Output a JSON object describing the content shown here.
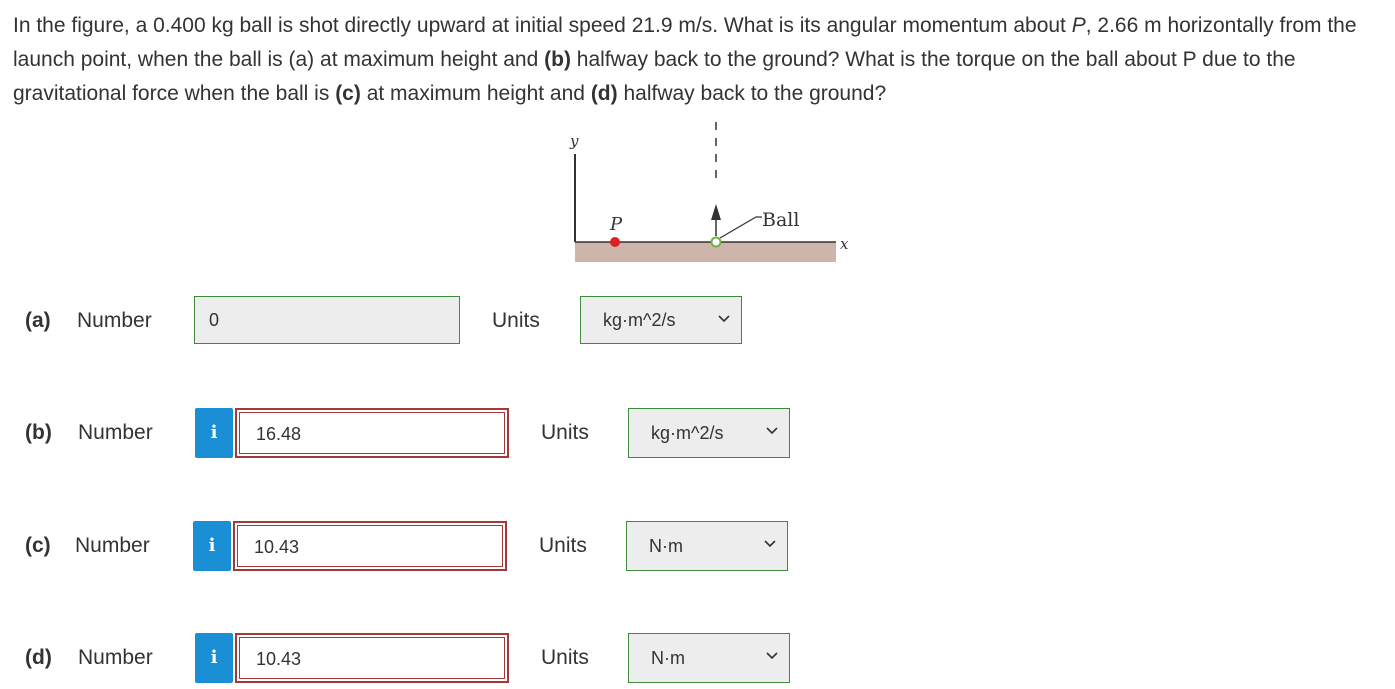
{
  "question": {
    "text_1": "In the figure, a 0.400 kg ball is shot directly upward at initial speed 21.9 m/s. What is its angular momentum about ",
    "p_italic": "P",
    "text_2": ", 2.66 m horizontally from the launch point, when the ball is (a) at maximum height and ",
    "b_label": "(b)",
    "text_3": " halfway back to the ground? What is the torque on the ball about P due to the gravitational force when the ball is ",
    "c_label": "(c)",
    "text_4": " at maximum height and ",
    "d_label": "(d)",
    "text_5": " halfway back to the ground?"
  },
  "figure": {
    "y_label": "y",
    "x_label": "x",
    "p_label": "P",
    "ball_label": "Ball",
    "colors": {
      "ground": "#cdb5ab",
      "point_p": "#e02020",
      "ball": "#6db33f",
      "line": "#333333"
    }
  },
  "rows": [
    {
      "part": "(a)",
      "label": "Number",
      "value": "0",
      "units_label": "Units",
      "units": "kg·m^2/s",
      "has_info": false
    },
    {
      "part": "(b)",
      "label": "Number",
      "value": "16.48",
      "units_label": "Units",
      "units": "kg·m^2/s",
      "has_info": true
    },
    {
      "part": "(c)",
      "label": "Number",
      "value": "10.43",
      "units_label": "Units",
      "units": "N·m",
      "has_info": true
    },
    {
      "part": "(d)",
      "label": "Number",
      "value": "10.43",
      "units_label": "Units",
      "units": "N·m",
      "has_info": true
    }
  ],
  "info_icon": "i",
  "colors": {
    "info_button": "#1a8fd6",
    "error_border": "#a23a3a",
    "field_border": "#3c8c3c",
    "field_bg": "#ededed"
  }
}
